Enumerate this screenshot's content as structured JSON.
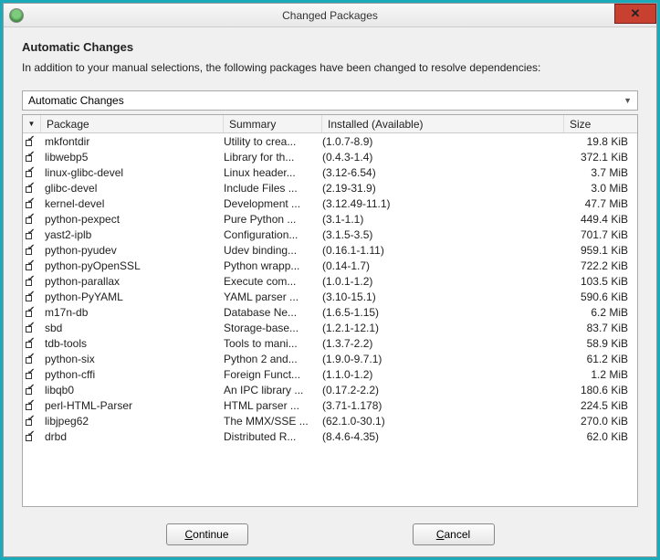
{
  "window": {
    "title": "Changed Packages"
  },
  "heading": "Automatic Changes",
  "subtext": "In addition to your manual selections, the following packages have been changed to resolve dependencies:",
  "dropdown": {
    "selected": "Automatic Changes"
  },
  "columns": {
    "package": "Package",
    "summary": "Summary",
    "installed": "Installed (Available)",
    "size": "Size"
  },
  "rows": [
    {
      "pkg": "mkfontdir",
      "sum": "Utility to crea...",
      "inst": "(1.0.7-8.9)",
      "size": "19.8 KiB"
    },
    {
      "pkg": "libwebp5",
      "sum": "Library for th...",
      "inst": "(0.4.3-1.4)",
      "size": "372.1 KiB"
    },
    {
      "pkg": "linux-glibc-devel",
      "sum": "Linux header...",
      "inst": "(3.12-6.54)",
      "size": "3.7 MiB"
    },
    {
      "pkg": "glibc-devel",
      "sum": "Include Files ...",
      "inst": "(2.19-31.9)",
      "size": "3.0 MiB"
    },
    {
      "pkg": "kernel-devel",
      "sum": "Development ...",
      "inst": "(3.12.49-11.1)",
      "size": "47.7 MiB"
    },
    {
      "pkg": "python-pexpect",
      "sum": "Pure Python ...",
      "inst": "(3.1-1.1)",
      "size": "449.4 KiB"
    },
    {
      "pkg": "yast2-iplb",
      "sum": "Configuration...",
      "inst": "(3.1.5-3.5)",
      "size": "701.7 KiB"
    },
    {
      "pkg": "python-pyudev",
      "sum": "Udev binding...",
      "inst": "(0.16.1-1.11)",
      "size": "959.1 KiB"
    },
    {
      "pkg": "python-pyOpenSSL",
      "sum": "Python wrapp...",
      "inst": "(0.14-1.7)",
      "size": "722.2 KiB"
    },
    {
      "pkg": "python-parallax",
      "sum": "Execute com...",
      "inst": "(1.0.1-1.2)",
      "size": "103.5 KiB"
    },
    {
      "pkg": "python-PyYAML",
      "sum": "YAML parser ...",
      "inst": "(3.10-15.1)",
      "size": "590.6 KiB"
    },
    {
      "pkg": "m17n-db",
      "sum": "Database Ne...",
      "inst": "(1.6.5-1.15)",
      "size": "6.2 MiB"
    },
    {
      "pkg": "sbd",
      "sum": "Storage-base...",
      "inst": "(1.2.1-12.1)",
      "size": "83.7 KiB"
    },
    {
      "pkg": "tdb-tools",
      "sum": "Tools to mani...",
      "inst": "(1.3.7-2.2)",
      "size": "58.9 KiB"
    },
    {
      "pkg": "python-six",
      "sum": "Python 2 and...",
      "inst": "(1.9.0-9.7.1)",
      "size": "61.2 KiB"
    },
    {
      "pkg": "python-cffi",
      "sum": "Foreign Funct...",
      "inst": "(1.1.0-1.2)",
      "size": "1.2 MiB"
    },
    {
      "pkg": "libqb0",
      "sum": "An IPC library ...",
      "inst": "(0.17.2-2.2)",
      "size": "180.6 KiB"
    },
    {
      "pkg": "perl-HTML-Parser",
      "sum": "HTML parser ...",
      "inst": "(3.71-1.178)",
      "size": "224.5 KiB"
    },
    {
      "pkg": "libjpeg62",
      "sum": "The MMX/SSE ...",
      "inst": "(62.1.0-30.1)",
      "size": "270.0 KiB"
    },
    {
      "pkg": "drbd",
      "sum": "Distributed R...",
      "inst": "(8.4.6-4.35)",
      "size": "62.0 KiB"
    }
  ],
  "buttons": {
    "continue": "ontinue",
    "continue_key": "C",
    "cancel": "ancel",
    "cancel_key": "C"
  }
}
